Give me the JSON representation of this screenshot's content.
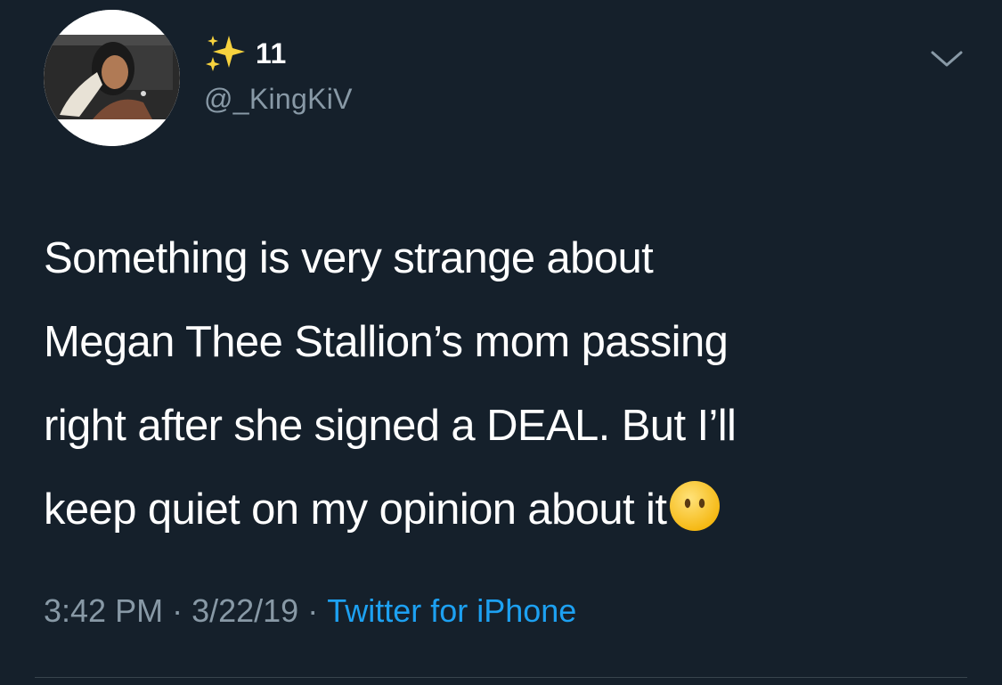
{
  "tweet": {
    "display_name": "11",
    "name_icon": "sparkles-icon",
    "handle": "@_KingKiV",
    "text": "Something is very strange about\nMegan Thee Stallion’s mom passing\nright after she signed a DEAL. But I’ll\nkeep quiet on my opinion about it",
    "text_emoji": "face-without-mouth-icon",
    "time": "3:42 PM",
    "separator": "·",
    "date": "3/22/19",
    "source": "Twitter for iPhone",
    "menu_icon": "chevron-down-icon"
  },
  "colors": {
    "background": "#15202b",
    "text": "#ffffff",
    "secondary_text": "#8899a6",
    "link": "#1da1f2",
    "divider": "#38444d"
  }
}
